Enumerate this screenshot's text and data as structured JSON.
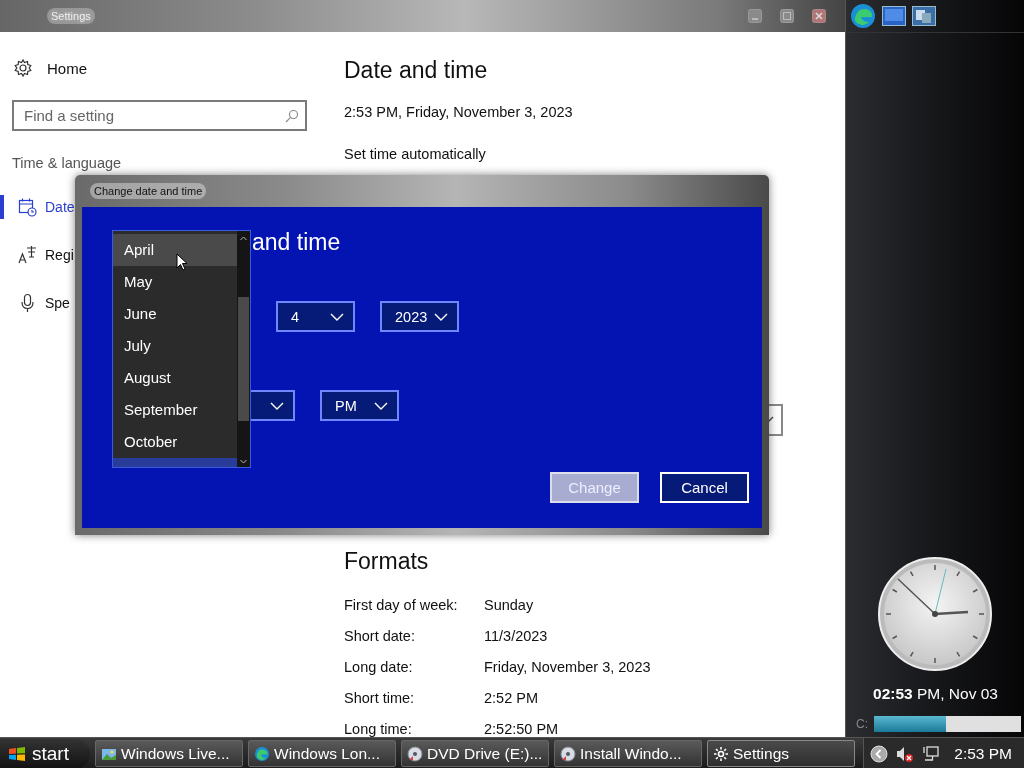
{
  "settings_window": {
    "title": "Settings",
    "home": "Home",
    "search": {
      "placeholder": "Find a setting"
    },
    "section": "Time & language",
    "nav_items": [
      {
        "kind": "date",
        "label": "Date",
        "selected": true
      },
      {
        "kind": "region",
        "label": "Regi",
        "selected": false
      },
      {
        "kind": "speech",
        "label": "Spe",
        "selected": false
      }
    ],
    "page_title": "Date and time",
    "current_time": "2:53 PM, Friday, November 3, 2023",
    "set_time_automatically": "Set time automatically",
    "formats": {
      "title": "Formats",
      "rows": [
        {
          "label": "First day of week:",
          "value": "Sunday"
        },
        {
          "label": "Short date:",
          "value": "11/3/2023"
        },
        {
          "label": "Long date:",
          "value": "Friday, November 3, 2023"
        },
        {
          "label": "Short time:",
          "value": "2:52 PM"
        },
        {
          "label": "Long time:",
          "value": "2:52:50 PM"
        }
      ]
    }
  },
  "dialog": {
    "title": "Change date and time",
    "heading": "and time",
    "date_fields": [
      {
        "value": "4"
      },
      {
        "value": "2023"
      }
    ],
    "time_fields": [
      {
        "kind": "covered"
      },
      {
        "kind": "dropdown",
        "value": "PM"
      }
    ],
    "buttons": [
      {
        "label": "Change",
        "disabled": true
      },
      {
        "label": "Cancel",
        "disabled": false
      }
    ],
    "month_list": {
      "items": [
        {
          "label": "April",
          "hovered": true,
          "selected": false
        },
        {
          "label": "May",
          "hovered": false,
          "selected": false
        },
        {
          "label": "June",
          "hovered": false,
          "selected": false
        },
        {
          "label": "July",
          "hovered": false,
          "selected": false
        },
        {
          "label": "August",
          "hovered": false,
          "selected": false
        },
        {
          "label": "September",
          "hovered": false,
          "selected": false
        },
        {
          "label": "October",
          "hovered": false,
          "selected": false
        },
        {
          "hovered": false,
          "selected": true
        }
      ]
    }
  },
  "sidebar": {
    "clock_text": "**02:53** PM, Nov 03",
    "drive": {
      "label": "C:",
      "level": 0.49
    }
  },
  "taskbar": {
    "start": "start",
    "tasks": [
      {
        "kind": "photo",
        "label": "Windows Live...",
        "active": false
      },
      {
        "kind": "browser",
        "label": "Windows Lon...",
        "active": false
      },
      {
        "kind": "disc",
        "label": "DVD Drive (E:)...",
        "active": false
      },
      {
        "kind": "disc",
        "label": "Install Windo...",
        "active": false
      },
      {
        "kind": "gear",
        "label": "Settings",
        "active": true
      }
    ],
    "volume_muted": true,
    "time": "2:53 PM"
  }
}
